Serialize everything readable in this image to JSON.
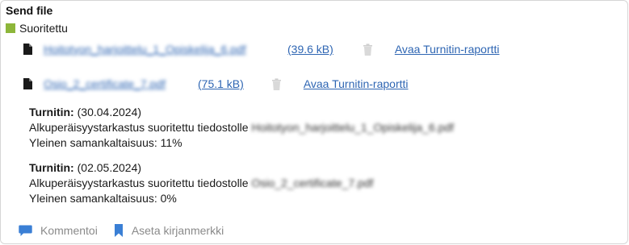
{
  "panel": {
    "title": "Send file",
    "status_label": "Suoritettu",
    "status_color": "#8db63a"
  },
  "files": [
    {
      "name": "Hoitotyon_harjoittelu_1_Opiskelija_6.pdf",
      "size": "(39.6 kB)",
      "report_label": "Avaa Turnitin-raportti",
      "icon": "file-icon",
      "delete_icon": "trash-icon"
    },
    {
      "name": "Osio_2_certificate_7.pdf",
      "size": "(75.1 kB)",
      "report_label": "Avaa Turnitin-raportti",
      "icon": "file-icon",
      "delete_icon": "trash-icon"
    }
  ],
  "turnitin_results": [
    {
      "heading": "Turnitin:",
      "date": "(30.04.2024)",
      "check_text": "Alkuperäisyystarkastus suoritettu tiedostolle",
      "file_name": "Hoitotyon_harjoittelu_1_Opiskelija_6.pdf",
      "similarity": "Yleinen samankaltaisuus: 11%"
    },
    {
      "heading": "Turnitin:",
      "date": "(02.05.2024)",
      "check_text": "Alkuperäisyystarkastus suoritettu tiedostolle",
      "file_name": "Osio_2_certificate_7.pdf",
      "similarity": "Yleinen samankaltaisuus: 0%"
    }
  ],
  "actions": {
    "comment_label": "Kommentoi",
    "bookmark_label": "Aseta kirjanmerkki",
    "accent": "#3a7fd5"
  }
}
